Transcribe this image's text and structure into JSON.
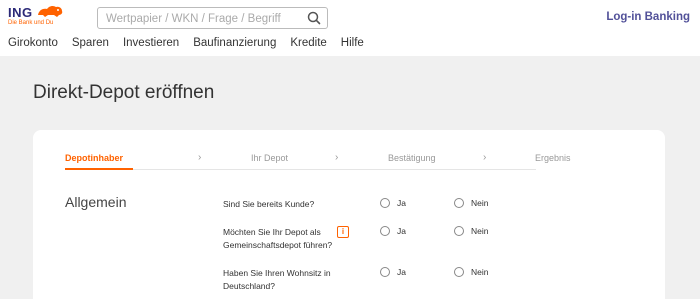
{
  "brand": {
    "name": "ING",
    "tagline": "Die Bank und Du",
    "lion_color": "#ff6200",
    "primary_color": "#2c2a78"
  },
  "search": {
    "placeholder": "Wertpapier / WKN / Frage / Begriff",
    "value": "",
    "icon": "search-icon"
  },
  "header": {
    "login_label": "Log-in Banking"
  },
  "nav": {
    "items": [
      "Girokonto",
      "Sparen",
      "Investieren",
      "Baufinanzierung",
      "Kredite",
      "Hilfe"
    ]
  },
  "page": {
    "title": "Direkt-Depot eröffnen"
  },
  "steps": {
    "items": [
      {
        "label": "Depotinhaber",
        "active": true
      },
      {
        "label": "Ihr Depot",
        "active": false
      },
      {
        "label": "Bestätigung",
        "active": false
      },
      {
        "label": "Ergebnis",
        "active": false
      }
    ],
    "separator": "›",
    "active_color": "#ff6200"
  },
  "section": {
    "title": "Allgemein"
  },
  "questions": [
    {
      "line1": "Sind Sie bereits Kunde?",
      "line2": "",
      "has_info": false,
      "yes": "Ja",
      "no": "Nein"
    },
    {
      "line1": "Möchten Sie Ihr Depot als",
      "line2": "Gemeinschaftsdepot führen?",
      "has_info": true,
      "info_label": "i",
      "yes": "Ja",
      "no": "Nein"
    },
    {
      "line1": "Haben Sie Ihren Wohnsitz in",
      "line2": "Deutschland?",
      "has_info": false,
      "yes": "Ja",
      "no": "Nein"
    }
  ]
}
